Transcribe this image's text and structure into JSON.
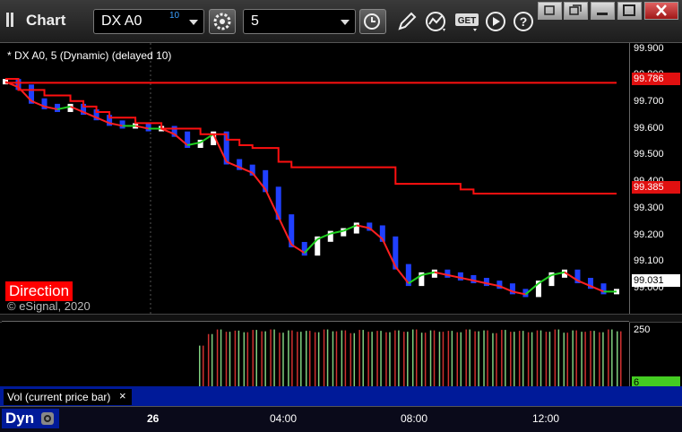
{
  "window": {
    "title": "Chart"
  },
  "toolbar": {
    "symbol_value": "DX A0",
    "symbol_superscript": "10",
    "interval_value": "5"
  },
  "chart": {
    "legend": "* DX A0, 5 (Dynamic) (delayed 10)",
    "direction_label": "Direction",
    "copyright": "© eSignal, 2020",
    "price_ticks": [
      "99.900",
      "99.800",
      "99.700",
      "99.600",
      "99.500",
      "99.400",
      "99.300",
      "99.200",
      "99.100",
      "99.000"
    ],
    "upper_line_value": "99.786",
    "lower_line_value": "99.385",
    "last_price": "99.031",
    "volume_scale": "250",
    "volume_last": "6",
    "volume_label": "Vol (current price bar)",
    "close_symbol": "×",
    "workspace_label": "Dyn",
    "time_labels": [
      "26",
      "04:00",
      "08:00",
      "12:00"
    ]
  },
  "colors": {
    "up_bar": "#ffffff",
    "down_bar": "#2040ff",
    "stop_line": "#ff1010",
    "ma_up": "#20d020",
    "ma_down": "#ff2020",
    "vol_up": "#80d080",
    "vol_down": "#d03030",
    "panel_blue": "#001a99"
  },
  "chart_data": {
    "type": "line",
    "ylim": [
      98.95,
      99.93
    ],
    "series": [
      {
        "values": [
          99.79,
          99.77,
          99.72,
          99.7,
          99.69,
          99.7,
          99.68,
          99.66,
          99.64,
          99.63,
          99.63,
          99.62,
          99.62,
          99.6,
          99.56,
          99.57,
          99.6,
          99.5,
          99.48,
          99.46,
          99.4,
          99.3,
          99.2,
          99.17,
          99.22,
          99.24,
          99.25,
          99.27,
          99.26,
          99.22,
          99.12,
          99.06,
          99.09,
          99.1,
          99.09,
          99.08,
          99.07,
          99.06,
          99.05,
          99.03,
          99.02,
          99.06,
          99.09,
          99.1,
          99.07,
          99.05,
          99.03,
          99.03
        ]
      },
      {
        "values": [
          99.786,
          99.786,
          99.786,
          99.786,
          99.786,
          99.786,
          99.786,
          99.786,
          99.786,
          99.786,
          99.786,
          99.786,
          99.786,
          99.786,
          99.786,
          99.786,
          99.786,
          99.786,
          99.786,
          99.786,
          99.786,
          99.786,
          99.786,
          99.786,
          99.786,
          99.786,
          99.786,
          99.786,
          99.786,
          99.786,
          99.786,
          99.786,
          99.786,
          99.786,
          99.786,
          99.786,
          99.786,
          99.786,
          99.786,
          99.786,
          99.786,
          99.786,
          99.786,
          99.786,
          99.786,
          99.786,
          99.786,
          99.786
        ]
      },
      {
        "values": [
          99.8,
          99.76,
          99.76,
          99.74,
          99.74,
          99.72,
          99.7,
          99.68,
          99.66,
          99.66,
          99.64,
          99.64,
          99.62,
          99.62,
          99.62,
          99.6,
          99.6,
          99.58,
          99.56,
          99.55,
          99.55,
          99.5,
          99.48,
          99.48,
          99.48,
          99.48,
          99.48,
          99.48,
          99.48,
          99.48,
          99.42,
          99.42,
          99.42,
          99.42,
          99.42,
          99.4,
          99.385,
          99.385,
          99.385,
          99.385,
          99.385,
          99.385,
          99.385,
          99.385,
          99.385,
          99.385,
          99.385,
          99.385
        ]
      }
    ],
    "volume": [
      180,
      230,
      250,
      240,
      245,
      238,
      248,
      242,
      250,
      236,
      246,
      240,
      244,
      238,
      250,
      242,
      246,
      234,
      248,
      240,
      244,
      238,
      246,
      240,
      250,
      236,
      246,
      240,
      244,
      238,
      250,
      242,
      246,
      234,
      248,
      240,
      244,
      238,
      246,
      240,
      250,
      236,
      246,
      240,
      244,
      238,
      250,
      242
    ]
  }
}
